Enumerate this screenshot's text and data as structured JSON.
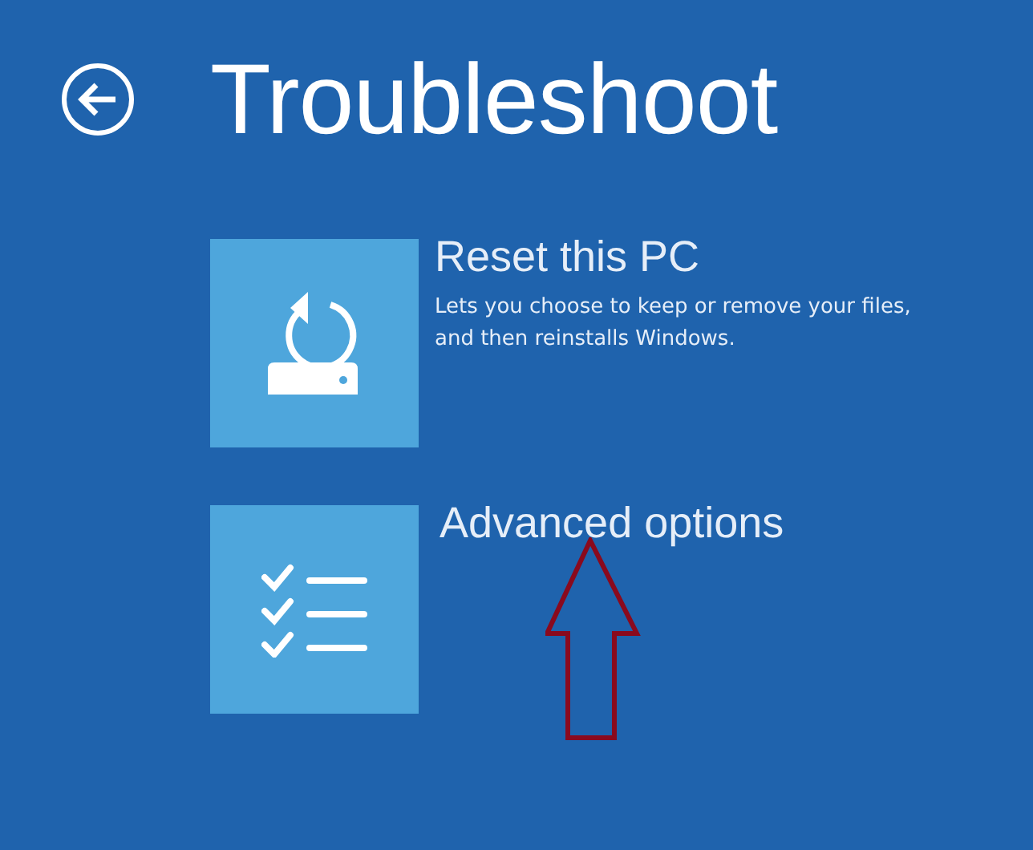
{
  "header": {
    "title": "Troubleshoot"
  },
  "options": [
    {
      "kind": "reset",
      "title": "Reset this PC",
      "description": "Lets you choose to keep or remove your files, and then reinstalls Windows."
    },
    {
      "kind": "advanced",
      "title": "Advanced options"
    }
  ]
}
